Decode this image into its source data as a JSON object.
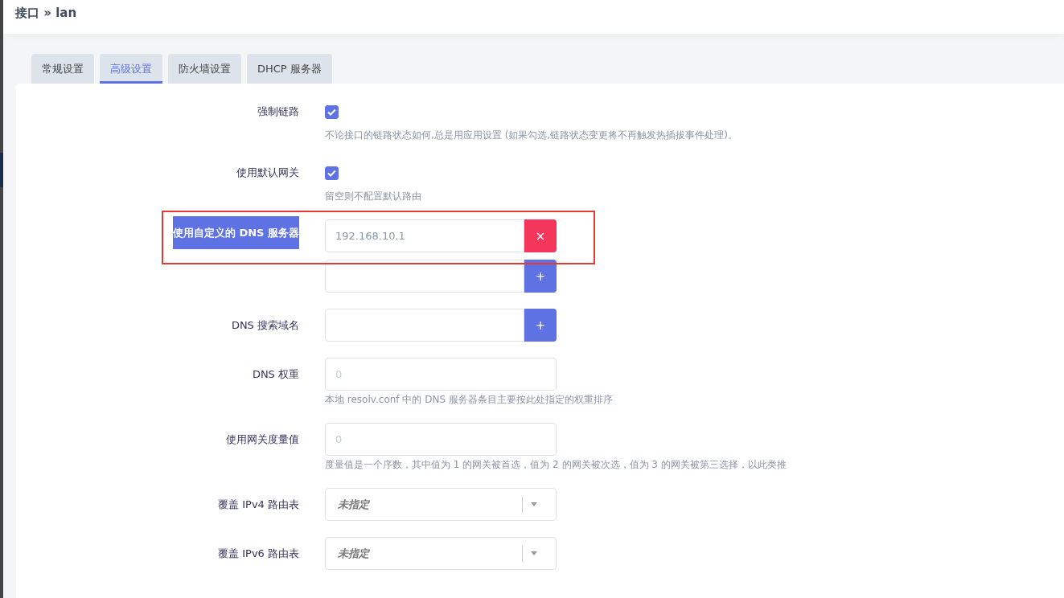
{
  "header": {
    "title": "接口 » lan"
  },
  "tabs": [
    {
      "label": "常规设置",
      "selected": false
    },
    {
      "label": "高级设置",
      "selected": true
    },
    {
      "label": "防火墙设置",
      "selected": false
    },
    {
      "label": "DHCP 服务器",
      "selected": false
    }
  ],
  "rows": [
    {
      "kind": "checkbox",
      "label": "强制链路",
      "checked": true,
      "description": "不论接口的链路状态如何,总是用应用设置 (如果勾选,链路状态变更将不再触发热插拔事件处理)。"
    },
    {
      "kind": "checkbox",
      "label": "使用默认网关",
      "checked": true,
      "description": "留空则不配置默认路由"
    },
    {
      "kind": "list",
      "label": "使用自定义的 DNS 服务器",
      "highlighted": true,
      "outlined": true,
      "entries": [
        {
          "value": "192.168.10.1",
          "button": {
            "kind": "remove",
            "symbol": "×"
          }
        },
        {
          "button": {
            "kind": "add",
            "symbol": "+"
          }
        }
      ]
    },
    {
      "kind": "list",
      "label": "DNS 搜索域名",
      "highlighted": false,
      "outlined": false,
      "entries": [
        {
          "button": {
            "kind": "add",
            "symbol": "+"
          }
        }
      ]
    },
    {
      "kind": "text",
      "label": "DNS 权重",
      "placeholder": "0",
      "description": "本地 resolv.conf 中的 DNS 服务器条目主要按此处指定的权重排序"
    },
    {
      "kind": "text",
      "label": "使用网关度量值",
      "placeholder": "0",
      "description": "度量值是一个序数，其中值为 1 的网关被首选，值为 2 的网关被次选，值为 3 的网关被第三选择，以此类推"
    },
    {
      "kind": "select",
      "label": "覆盖 IPv4 路由表",
      "value": "未指定"
    },
    {
      "kind": "select",
      "label": "覆盖 IPv6 路由表",
      "value": "未指定"
    }
  ]
}
